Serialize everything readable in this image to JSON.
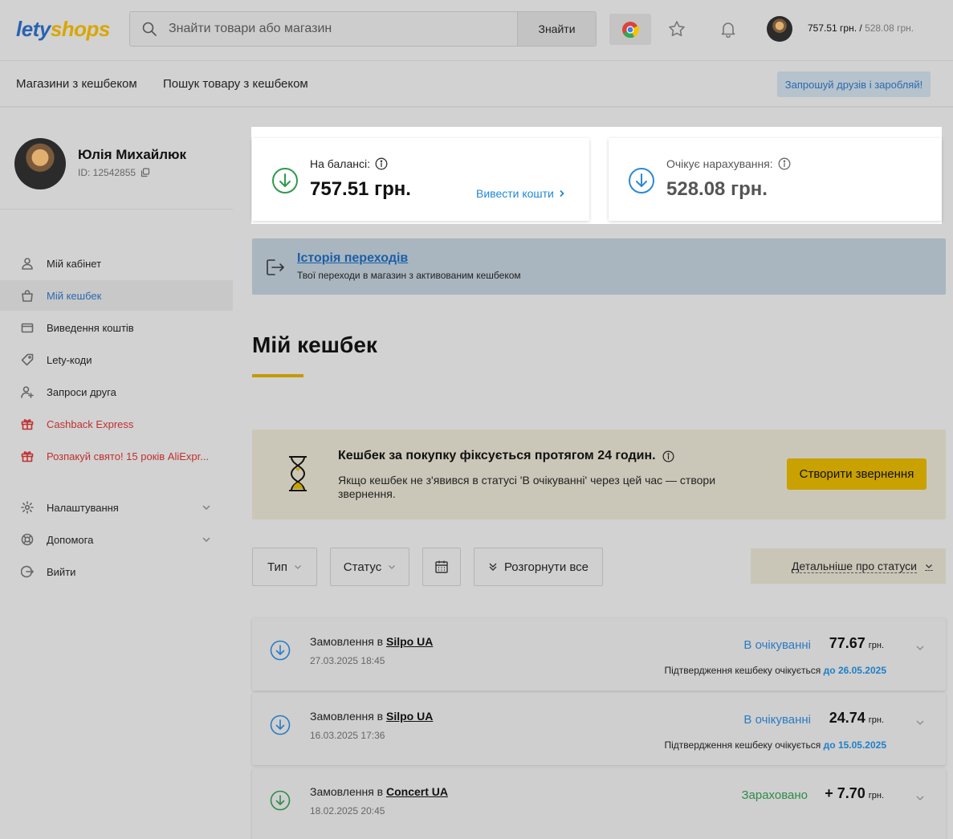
{
  "header": {
    "logo_part1": "lety",
    "logo_part2": "shops",
    "search_placeholder": "Знайти товари або магазин",
    "search_button": "Знайти",
    "balance": "757.51 грн.",
    "balance_sep": " / ",
    "pending": "528.08 грн.",
    "icons": [
      "search-icon",
      "chrome-icon",
      "star-icon",
      "bell-icon"
    ]
  },
  "nav": {
    "item1": "Магазини з кешбеком",
    "item2": "Пошук товару з кешбеком",
    "invite": "Запрошуй друзів і заробляй!"
  },
  "profile": {
    "name": "Юлія Михайлюк",
    "id": "ID: 12542855"
  },
  "menu": [
    {
      "label": "Мій кабінет",
      "icon": "user-icon"
    },
    {
      "label": "Мій кешбек",
      "icon": "bag-icon",
      "active": true
    },
    {
      "label": "Виведення коштів",
      "icon": "wallet-icon"
    },
    {
      "label": "Lety-коди",
      "icon": "tag-icon"
    },
    {
      "label": "Запроси друга",
      "icon": "user-plus-icon"
    },
    {
      "label": "Cashback Express",
      "icon": "gift-icon",
      "color": "#c03030"
    },
    {
      "label": "Розпакуй свято! 15 років AliExpr...",
      "icon": "gift-icon",
      "color": "#c03030"
    },
    {
      "label": "Налаштування",
      "icon": "gear-icon"
    },
    {
      "label": "Допомога",
      "icon": "lifebuoy-icon"
    },
    {
      "label": "Вийти",
      "icon": "logout-icon"
    }
  ],
  "balance_card": {
    "label": "На балансі:",
    "value": "757.51 грн.",
    "link": "Вивести кошти"
  },
  "pending_card": {
    "label": "Очікує нарахування:",
    "value": "528.08 грн."
  },
  "history": {
    "title": "Історія переходів",
    "subtitle": "Твої переходи в магазин з активованим кешбеком"
  },
  "page_title": "Мій кешбек",
  "notice": {
    "heading": "Кешбек за покупку фіксується протягом 24 годин.",
    "text": "Якщо кешбек не з'явився в статусі 'В очікуванні' через цей час — створи звернення.",
    "button": "Створити звернення"
  },
  "filters": {
    "type": "Тип",
    "status": "Статус",
    "expand": "Розгорнути все",
    "details": "Детальніше про статуси"
  },
  "orders": [
    {
      "prefix": "Замовлення в",
      "store": "Silpo UA",
      "date": "27.03.2025 18:45",
      "status": "В очікуванні",
      "amount": "77.67",
      "currency": "грн.",
      "confirm": "Підтвердження кешбеку очікується",
      "confirm_date": "до 26.05.2025"
    },
    {
      "prefix": "Замовлення в",
      "store": "Silpo UA",
      "date": "16.03.2025 17:36",
      "status": "В очікуванні",
      "amount": "24.74",
      "currency": "грн.",
      "confirm": "Підтвердження кешбеку очікується",
      "confirm_date": "до 15.05.2025"
    },
    {
      "prefix": "Замовлення в",
      "store": "Concert UA",
      "date": "18.02.2025 20:45",
      "status": "Зараховано",
      "amount": "+ 7.70",
      "currency": "грн.",
      "confirm": "",
      "confirm_date": ""
    }
  ],
  "colors": {
    "accent_blue": "#2a6ab0",
    "accent_yellow": "#c9a100",
    "pending": "#2a7bc4",
    "credited": "#2e8b4a",
    "promo_red": "#c03030"
  }
}
